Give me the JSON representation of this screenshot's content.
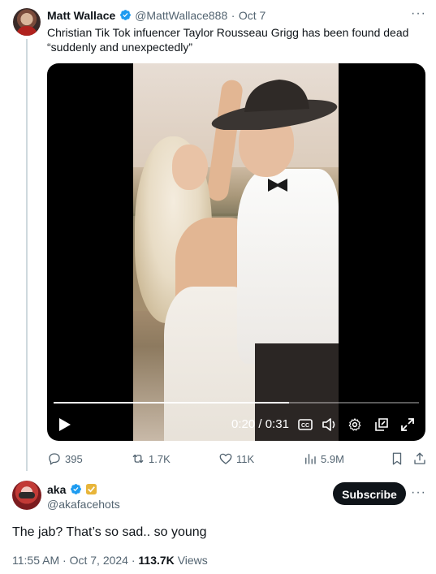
{
  "tweet": {
    "author_name": "Matt Wallace",
    "author_handle": "@MattWallace888",
    "separator": "·",
    "date": "Oct 7",
    "text_line1": "Christian Tik Tok  infuencer Taylor Rousseau Grigg has been found dead",
    "text_line2": "“suddenly and unexpectedly”",
    "video": {
      "current_time": "0:20",
      "time_sep": "/",
      "duration": "0:31",
      "progress": 0.645
    },
    "actions": {
      "replies": "395",
      "retweets": "1.7K",
      "likes": "11K",
      "views": "5.9M"
    }
  },
  "reply": {
    "author_name": "aka",
    "author_handle": "@akafacehots",
    "subscribe_label": "Subscribe",
    "text": "The jab? That’s so sad.. so young",
    "time": "11:55 AM",
    "separator": "·",
    "date": "Oct 7, 2024",
    "separator2": "·",
    "views_count": "113.7K",
    "views_label": "Views"
  },
  "colors": {
    "verified_blue": "#1d9bf0",
    "gold_badge": "#e8b53a",
    "muted": "#536471",
    "text": "#0f1419"
  }
}
